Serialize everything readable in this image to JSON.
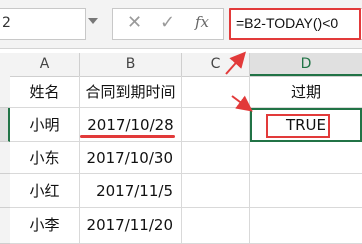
{
  "name_box": {
    "value": "2"
  },
  "formula_bar": {
    "cancel_icon": "✕",
    "enter_icon": "✓",
    "fx_label": "fx",
    "formula": "=B2-TODAY()<0"
  },
  "columns": [
    {
      "label": "A"
    },
    {
      "label": "B"
    },
    {
      "label": "C"
    },
    {
      "label": "D"
    }
  ],
  "rows": [
    {
      "a": "姓名",
      "b": "合同到期时间",
      "c": "",
      "d": "过期"
    },
    {
      "a": "小明",
      "b": "2017/10/28",
      "c": "",
      "d": "TRUE"
    },
    {
      "a": "小东",
      "b": "2017/10/30",
      "c": "",
      "d": ""
    },
    {
      "a": "小红",
      "b": "2017/11/5",
      "c": "",
      "d": ""
    },
    {
      "a": "小李",
      "b": "2017/11/20",
      "c": "",
      "d": ""
    }
  ],
  "colors": {
    "accent": "#217346",
    "annotation": "#e23a3a"
  }
}
